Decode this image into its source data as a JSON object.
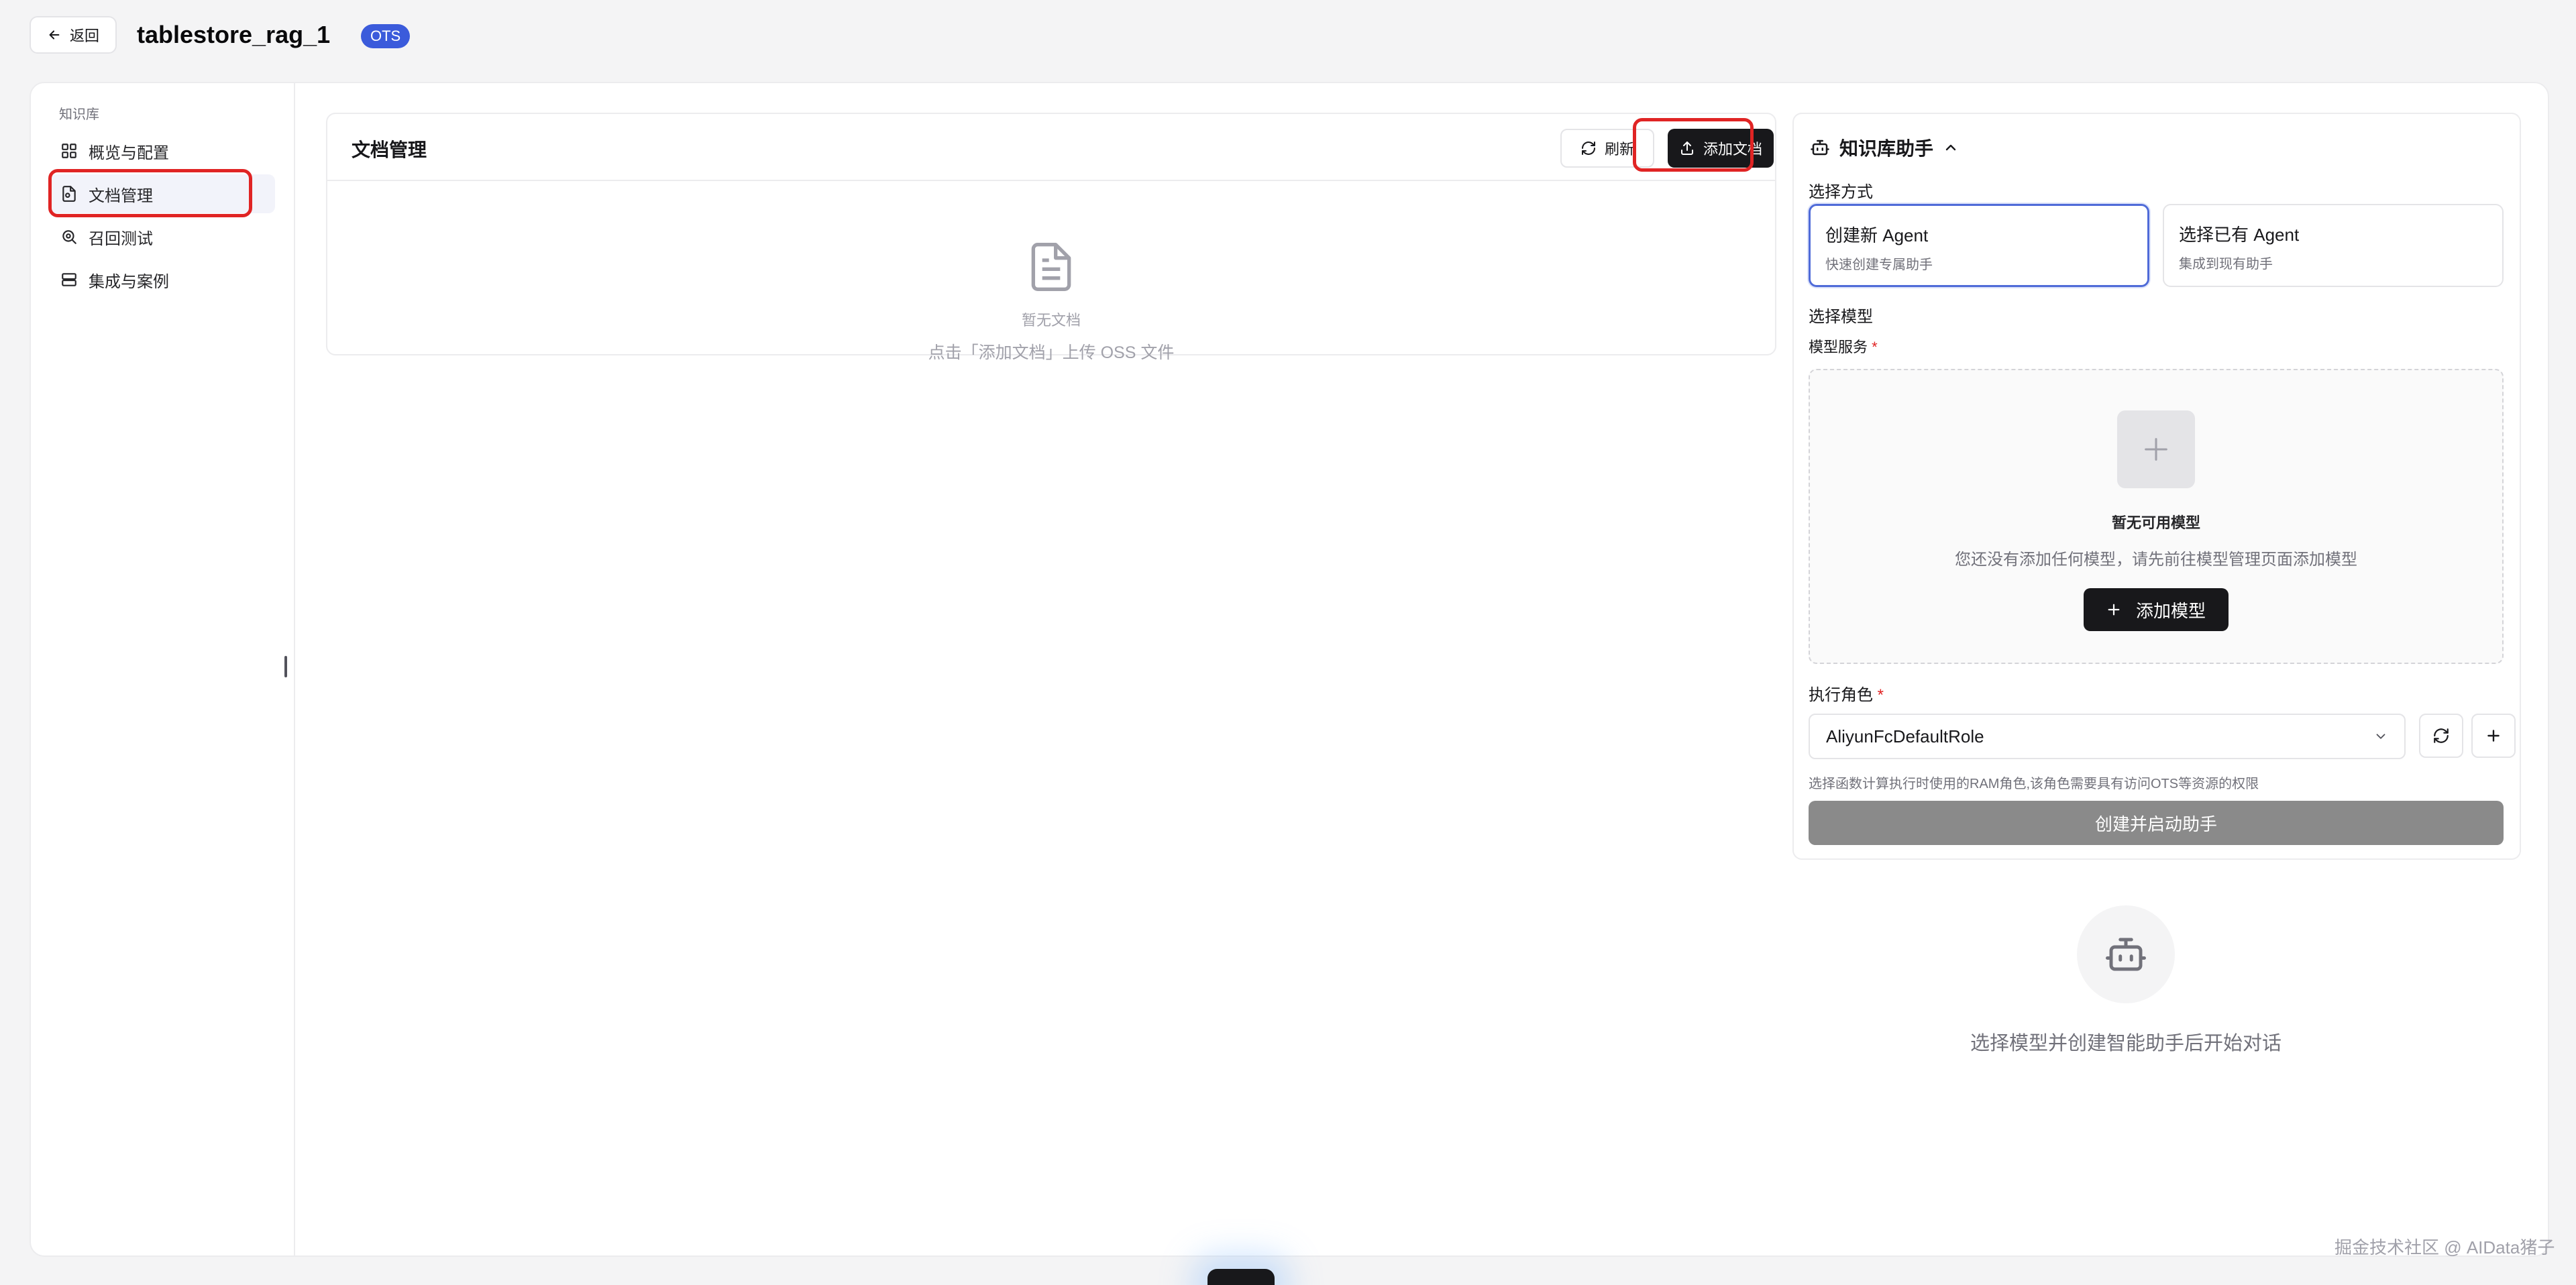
{
  "header": {
    "back_label": "返回",
    "kb_name": "tablestore_rag_1",
    "badge": "OTS"
  },
  "sidebar": {
    "caption": "知识库",
    "items": [
      {
        "label": "概览与配置",
        "icon": "grid-icon"
      },
      {
        "label": "文档管理",
        "icon": "document-icon",
        "active": true
      },
      {
        "label": "召回测试",
        "icon": "search-icon"
      },
      {
        "label": "集成与案例",
        "icon": "server-icon"
      }
    ]
  },
  "documents": {
    "title": "文档管理",
    "refresh_label": "刷新",
    "add_label": "添加文档",
    "empty_title": "暂无文档",
    "empty_hint": "点击「添加文档」上传 OSS 文件"
  },
  "assistant": {
    "title": "知识库助手",
    "mode_label": "选择方式",
    "modes": [
      {
        "title": "创建新 Agent",
        "subtitle": "快速创建专属助手",
        "selected": true
      },
      {
        "title": "选择已有 Agent",
        "subtitle": "集成到现有助手",
        "selected": false
      }
    ],
    "model_label": "选择模型",
    "service_label": "模型服务",
    "required_mark": "*",
    "no_model_title": "暂无可用模型",
    "no_model_hint": "您还没有添加任何模型，请先前往模型管理页面添加模型",
    "add_model_label": "添加模型",
    "role_label": "执行角色",
    "role_value": "AliyunFcDefaultRole",
    "role_hint": "选择函数计算执行时使用的RAM角色,该角色需要具有访问OTS等资源的权限",
    "create_label": "创建并启动助手"
  },
  "chat": {
    "empty_text": "选择模型并创建智能助手后开始对话"
  },
  "watermark": "掘金技术社区 @ AIData猪子",
  "colors": {
    "accent": "#3b5bdb",
    "highlight": "#e02424",
    "primary_button": "#18181b",
    "disabled_button": "#8a8a8a"
  }
}
